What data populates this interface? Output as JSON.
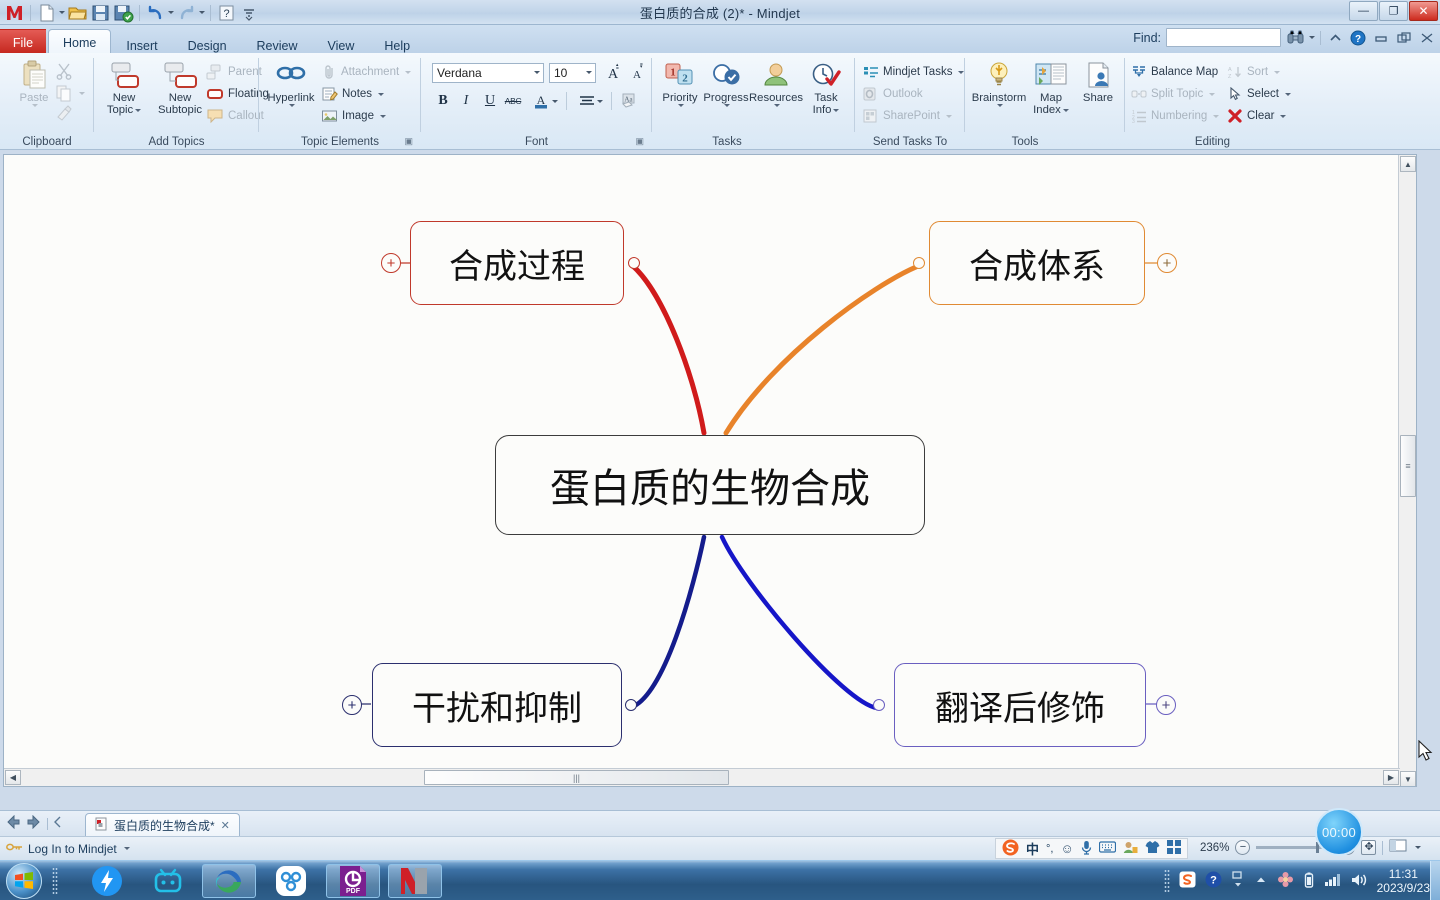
{
  "window": {
    "title": "蛋白质的合成 (2)* - Mindjet",
    "minimize_label": "—",
    "restore_label": "❐",
    "close_label": "✕"
  },
  "quick_access": {
    "items": [
      {
        "name": "mindjet-logo-icon",
        "label": "M"
      },
      {
        "name": "new-icon",
        "label": "New"
      },
      {
        "name": "open-icon",
        "label": "Open"
      },
      {
        "name": "save-icon",
        "label": "Save"
      },
      {
        "name": "save-upload-icon",
        "label": "Save & Upload"
      },
      {
        "name": "undo-icon",
        "label": "Undo"
      },
      {
        "name": "redo-icon",
        "label": "Redo"
      },
      {
        "name": "help-icon",
        "label": "Help"
      },
      {
        "name": "customize-qat-icon",
        "label": "Customize Quick Access Toolbar"
      }
    ]
  },
  "ribbon_tabs": [
    {
      "label": "File",
      "active": false
    },
    {
      "label": "Home",
      "active": true
    },
    {
      "label": "Insert",
      "active": false
    },
    {
      "label": "Design",
      "active": false
    },
    {
      "label": "Review",
      "active": false
    },
    {
      "label": "View",
      "active": false
    },
    {
      "label": "Help",
      "active": false
    }
  ],
  "find": {
    "label": "Find:",
    "value": "",
    "placeholder": ""
  },
  "titlebar_right_icons": [
    {
      "name": "binoculars-icon",
      "label": "Find"
    },
    {
      "name": "chevron-up-icon",
      "label": "Collapse Ribbon"
    },
    {
      "name": "help-circle-icon",
      "label": "Help"
    }
  ],
  "ribbon": {
    "groups": [
      {
        "name": "clipboard",
        "label": "Clipboard",
        "big": [
          {
            "label": "Paste",
            "lines": [
              "Paste"
            ],
            "icon": "paste-icon",
            "disabled": true,
            "dropdown": true
          }
        ],
        "small": [
          {
            "label": "Cut",
            "icon": "scissors-icon",
            "disabled": true,
            "text": ""
          },
          {
            "label": "Copy",
            "icon": "copy-icon",
            "disabled": true,
            "text": ""
          },
          {
            "label": "Format Painter",
            "icon": "format-painter-icon",
            "disabled": true,
            "text": ""
          }
        ]
      },
      {
        "name": "add-topics",
        "label": "Add Topics",
        "big": [
          {
            "label": "New Topic",
            "lines": [
              "New",
              "Topic"
            ],
            "icon": "new-topic-icon",
            "dropdown": true
          },
          {
            "label": "New Subtopic",
            "lines": [
              "New",
              "Subtopic"
            ],
            "icon": "new-subtopic-icon",
            "dropdown": false
          }
        ],
        "small": [
          {
            "label": "Parent",
            "icon": "parent-topic-icon",
            "disabled": true
          },
          {
            "label": "Floating",
            "icon": "floating-topic-icon",
            "disabled": false
          },
          {
            "label": "Callout",
            "icon": "callout-icon",
            "disabled": true
          }
        ]
      },
      {
        "name": "topic-elements",
        "label": "Topic Elements",
        "big": [
          {
            "label": "Hyperlink",
            "lines": [
              "Hyperlink"
            ],
            "icon": "hyperlink-icon",
            "dropdown": true
          }
        ],
        "small": [
          {
            "label": "Attachment",
            "icon": "attachment-icon",
            "disabled": true,
            "dropdown": true
          },
          {
            "label": "Notes",
            "icon": "notes-icon",
            "disabled": false,
            "dropdown": true
          },
          {
            "label": "Image",
            "icon": "image-icon",
            "disabled": false,
            "dropdown": true
          }
        ]
      },
      {
        "name": "font",
        "label": "Font",
        "font_family": "Verdana",
        "font_size": "10",
        "buttons": [
          {
            "name": "grow-font-button",
            "label": "A▲"
          },
          {
            "name": "shrink-font-button",
            "label": "A▼"
          },
          {
            "name": "bold-button",
            "label": "B"
          },
          {
            "name": "italic-button",
            "label": "I"
          },
          {
            "name": "underline-button",
            "label": "U"
          },
          {
            "name": "strikethrough-button",
            "label": "ABC"
          },
          {
            "name": "font-color-button",
            "label": "A"
          },
          {
            "name": "align-button",
            "label": "≡"
          },
          {
            "name": "clear-formatting-button",
            "label": "A"
          }
        ]
      },
      {
        "name": "tasks",
        "label": "Tasks",
        "big": [
          {
            "label": "Priority",
            "lines": [
              "Priority"
            ],
            "icon": "priority-icon",
            "dropdown": true
          },
          {
            "label": "Progress",
            "lines": [
              "Progress"
            ],
            "icon": "progress-icon",
            "dropdown": true
          },
          {
            "label": "Resources",
            "lines": [
              "Resources"
            ],
            "icon": "resources-icon",
            "dropdown": true
          },
          {
            "label": "Task Info",
            "lines": [
              "Task",
              "Info"
            ],
            "icon": "task-info-icon",
            "dropdown": true
          }
        ]
      },
      {
        "name": "send-tasks-to",
        "label": "Send Tasks To",
        "small": [
          {
            "label": "Mindjet Tasks",
            "icon": "mindjet-tasks-icon",
            "disabled": false,
            "dropdown": true
          },
          {
            "label": "Outlook",
            "icon": "outlook-icon",
            "disabled": true,
            "dropdown": false
          },
          {
            "label": "SharePoint",
            "icon": "sharepoint-icon",
            "disabled": true,
            "dropdown": true
          }
        ]
      },
      {
        "name": "tools",
        "label": "Tools",
        "big": [
          {
            "label": "Brainstorm",
            "lines": [
              "Brainstorm"
            ],
            "icon": "brainstorm-icon",
            "dropdown": true
          },
          {
            "label": "Map Index",
            "lines": [
              "Map",
              "Index"
            ],
            "icon": "map-index-icon",
            "dropdown": true
          },
          {
            "label": "Share",
            "lines": [
              "Share"
            ],
            "icon": "share-icon",
            "dropdown": false
          }
        ]
      },
      {
        "name": "editing",
        "label": "Editing",
        "small": [
          {
            "label": "Balance Map",
            "icon": "balance-map-icon",
            "disabled": false,
            "dropdown": false
          },
          {
            "label": "Split Topic",
            "icon": "split-topic-icon",
            "disabled": true,
            "dropdown": true
          },
          {
            "label": "Numbering",
            "icon": "numbering-icon",
            "disabled": true,
            "dropdown": true
          },
          {
            "label": "Sort",
            "icon": "sort-icon",
            "disabled": true,
            "dropdown": true
          },
          {
            "label": "Select",
            "icon": "select-icon",
            "disabled": false,
            "dropdown": true
          },
          {
            "label": "Clear",
            "icon": "clear-icon",
            "disabled": false,
            "dropdown": true
          }
        ]
      }
    ]
  },
  "map": {
    "central_topic": {
      "text": "蛋白质的生物合成",
      "border_color": "#3c3c3c"
    },
    "topics": [
      {
        "id": "topic-synthesis-process",
        "text": "合成过程",
        "border_color": "#c0392b",
        "branch_color": "#d01b1b",
        "position": "top-left",
        "expander": "+"
      },
      {
        "id": "topic-synthesis-system",
        "text": "合成体系",
        "border_color": "#e08a33",
        "branch_color": "#e8832a",
        "position": "top-right",
        "expander": "+"
      },
      {
        "id": "topic-interference-inhibition",
        "text": "干扰和抑制",
        "border_color": "#2b2f6e",
        "branch_color": "#141c8c",
        "position": "bottom-left",
        "expander": "+"
      },
      {
        "id": "topic-post-translational-modification",
        "text": "翻译后修饰",
        "border_color": "#6a5fc0",
        "branch_color": "#1616c8",
        "position": "bottom-right",
        "expander": "+"
      }
    ]
  },
  "doc_tab": {
    "label": "蛋白质的生物合成*",
    "close_label": "✕",
    "icon": "map-document-icon"
  },
  "status": {
    "login_label": "Log In to Mindjet",
    "zoom": "236%",
    "zoom_out_label": "−",
    "zoom_in_label": "+",
    "fit_label": "✥",
    "timer": "00:00"
  },
  "ime_tray": {
    "items": [
      {
        "name": "sogou-logo-icon",
        "label": "S"
      },
      {
        "name": "chinese-mode-icon",
        "label": "中"
      },
      {
        "name": "punctuation-icon",
        "label": "°,"
      },
      {
        "name": "emoji-icon",
        "label": "☺"
      },
      {
        "name": "voice-input-icon",
        "label": "🎤"
      },
      {
        "name": "soft-keyboard-icon",
        "label": "⌨"
      },
      {
        "name": "user-icon",
        "label": "👤"
      },
      {
        "name": "skin-icon",
        "label": "👕"
      },
      {
        "name": "toolbox-icon",
        "label": "▦"
      }
    ]
  },
  "taskbar": {
    "start_label": "Start",
    "items": [
      {
        "name": "taskbar-flash-icon",
        "label": "迅雷",
        "running": false
      },
      {
        "name": "taskbar-bilibili-icon",
        "label": "bilibili",
        "running": false
      },
      {
        "name": "taskbar-edge-icon",
        "label": "Microsoft Edge",
        "running": true
      },
      {
        "name": "taskbar-cloud-icon",
        "label": "云盘",
        "running": false
      },
      {
        "name": "taskbar-pdf-icon",
        "label": "PDF",
        "running": true
      },
      {
        "name": "taskbar-mindjet-icon",
        "label": "Mindjet",
        "running": true
      }
    ],
    "tray": [
      {
        "name": "tray-sogou-icon",
        "label": "S"
      },
      {
        "name": "tray-help-icon",
        "label": "?"
      },
      {
        "name": "tray-show-hidden-icon",
        "label": "▲"
      },
      {
        "name": "tray-flower-icon",
        "label": "✿"
      },
      {
        "name": "tray-battery-icon",
        "label": "🔋"
      },
      {
        "name": "tray-network-icon",
        "label": "📶"
      },
      {
        "name": "tray-volume-icon",
        "label": "🔊"
      }
    ],
    "clock_time": "11:31",
    "clock_date": "2023/9/23"
  }
}
